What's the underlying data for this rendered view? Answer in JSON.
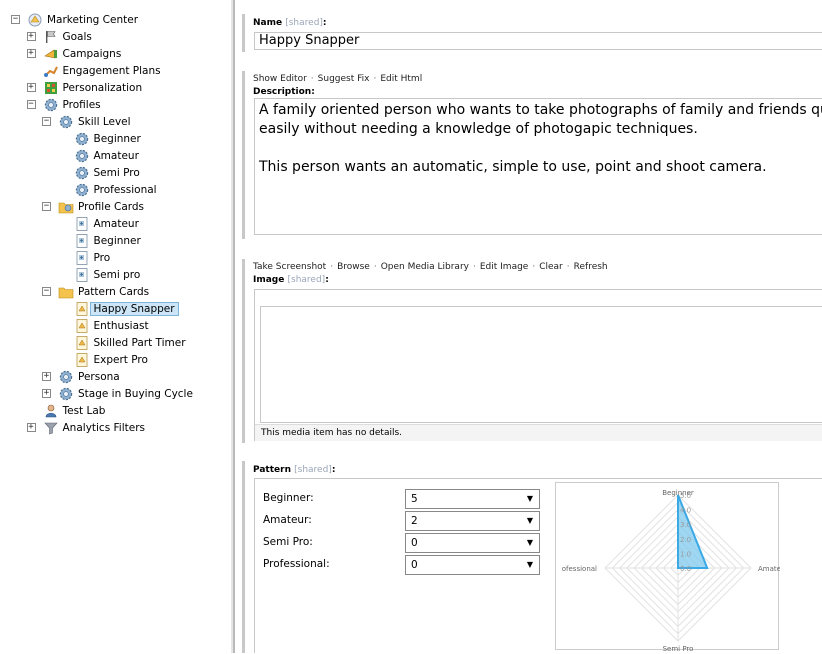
{
  "tree": [
    {
      "label": "Marketing Center",
      "toggle": "−",
      "icon": "marketing-center-icon",
      "level": 0
    },
    {
      "label": "Goals",
      "toggle": "+",
      "icon": "flag-icon",
      "level": 1
    },
    {
      "label": "Campaigns",
      "toggle": "+",
      "icon": "campaign-icon",
      "level": 1
    },
    {
      "label": "Engagement Plans",
      "toggle": "",
      "icon": "engagement-plan-icon",
      "level": 1
    },
    {
      "label": "Personalization",
      "toggle": "+",
      "icon": "personalization-icon",
      "level": 1
    },
    {
      "label": "Profiles",
      "toggle": "−",
      "icon": "profile-gear-icon",
      "level": 1
    },
    {
      "label": "Skill Level",
      "toggle": "−",
      "icon": "profile-gear-icon",
      "level": 2
    },
    {
      "label": "Beginner",
      "toggle": "",
      "icon": "profile-gear-icon",
      "level": 3
    },
    {
      "label": "Amateur",
      "toggle": "",
      "icon": "profile-gear-icon",
      "level": 3
    },
    {
      "label": "Semi Pro",
      "toggle": "",
      "icon": "profile-gear-icon",
      "level": 3
    },
    {
      "label": "Professional",
      "toggle": "",
      "icon": "profile-gear-icon",
      "level": 3
    },
    {
      "label": "Profile Cards",
      "toggle": "−",
      "icon": "profile-cards-folder-icon",
      "level": 2
    },
    {
      "label": "Amateur",
      "toggle": "",
      "icon": "profile-card-icon",
      "level": 3
    },
    {
      "label": "Beginner",
      "toggle": "",
      "icon": "profile-card-icon",
      "level": 3
    },
    {
      "label": "Pro",
      "toggle": "",
      "icon": "profile-card-icon",
      "level": 3
    },
    {
      "label": "Semi pro",
      "toggle": "",
      "icon": "profile-card-icon",
      "level": 3
    },
    {
      "label": "Pattern Cards",
      "toggle": "−",
      "icon": "folder-icon",
      "level": 2
    },
    {
      "label": "Happy Snapper",
      "toggle": "",
      "icon": "pattern-card-icon",
      "level": 3,
      "selected": true
    },
    {
      "label": "Enthusiast",
      "toggle": "",
      "icon": "pattern-card-icon",
      "level": 3
    },
    {
      "label": "Skilled Part Timer",
      "toggle": "",
      "icon": "pattern-card-icon",
      "level": 3
    },
    {
      "label": "Expert Pro",
      "toggle": "",
      "icon": "pattern-card-icon",
      "level": 3
    },
    {
      "label": "Persona",
      "toggle": "+",
      "icon": "profile-gear-icon",
      "level": 2
    },
    {
      "label": "Stage in Buying Cycle",
      "toggle": "+",
      "icon": "profile-gear-icon",
      "level": 2
    },
    {
      "label": "Test Lab",
      "toggle": "",
      "icon": "test-lab-icon",
      "level": 1
    },
    {
      "label": "Analytics Filters",
      "toggle": "+",
      "icon": "filter-icon",
      "level": 1
    }
  ],
  "name_field": {
    "label": "Name",
    "shared": "[shared]",
    "colon": ":",
    "value": "Happy Snapper"
  },
  "description_field": {
    "commands": [
      "Show Editor",
      "Suggest Fix",
      "Edit Html"
    ],
    "label": "Description:",
    "paragraphs": [
      "A family oriented person who wants to take photographs of family and friends quickly an",
      "easily without needing a knowledge of photogapic techniques.",
      "This person wants an automatic, simple to use, point and shoot camera."
    ]
  },
  "image_field": {
    "commands": [
      "Take Screenshot",
      "Browse",
      "Open Media Library",
      "Edit Image",
      "Clear",
      "Refresh"
    ],
    "label": "Image",
    "shared": "[shared]",
    "colon": ":",
    "details": "This media item has no details."
  },
  "pattern_field": {
    "label": "Pattern",
    "shared": "[shared]",
    "colon": ":",
    "rows": [
      {
        "label": "Beginner:",
        "value": "5"
      },
      {
        "label": "Amateur:",
        "value": "2"
      },
      {
        "label": "Semi Pro:",
        "value": "0"
      },
      {
        "label": "Professional:",
        "value": "0"
      }
    ]
  },
  "chart_data": {
    "type": "radar",
    "axes": [
      "Beginner",
      "Amateur",
      "Semi Pro",
      "ofessional"
    ],
    "values": [
      5,
      2,
      0,
      0
    ],
    "ticks": [
      "0.0",
      "1.0",
      "2.0",
      "3.0",
      "4.0",
      "5.0"
    ],
    "range": [
      0,
      5
    ],
    "fill_color": "#7fc9ef",
    "line_color": "#3aa9e6"
  }
}
